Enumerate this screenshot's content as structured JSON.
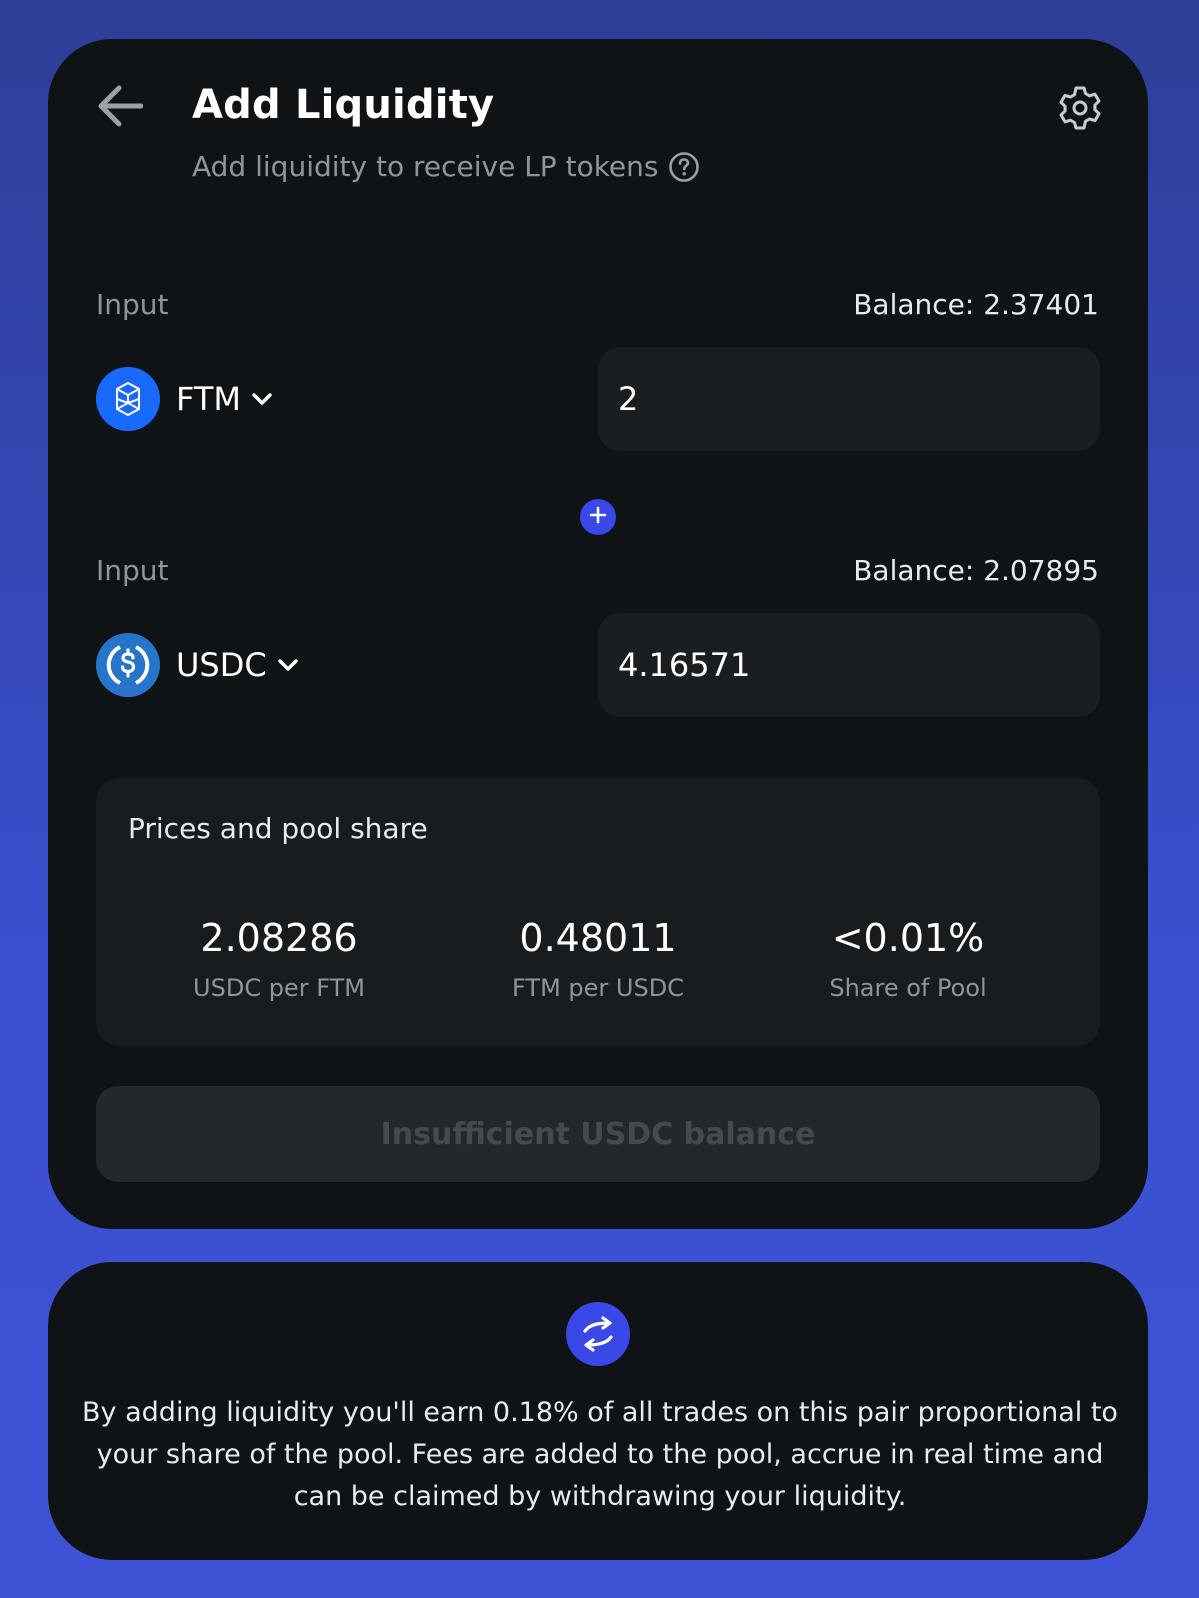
{
  "header": {
    "title": "Add Liquidity",
    "subtitle": "Add liquidity to receive LP tokens",
    "back_icon": "arrow-left-icon",
    "settings_icon": "gear-icon",
    "help_icon": "question-circle-icon"
  },
  "input_a": {
    "label": "Input",
    "balance": "Balance: 2.37401",
    "token": "FTM",
    "token_icon": "fantom-logo-icon",
    "token_color": "#1969ff",
    "amount": "2"
  },
  "input_b": {
    "label": "Input",
    "balance": "Balance: 2.07895",
    "token": "USDC",
    "token_icon": "usdc-logo-icon",
    "token_color": "#2775ca",
    "amount": "4.16571"
  },
  "plus_icon": "plus-icon",
  "prices": {
    "title": "Prices and pool share",
    "stats": [
      {
        "value": "2.08286",
        "label": "USDC per FTM"
      },
      {
        "value": "0.48011",
        "label": "FTM per USDC"
      },
      {
        "value": "<0.01%",
        "label": "Share of Pool"
      }
    ]
  },
  "action": {
    "label": "Insufficient USDC balance"
  },
  "info": {
    "icon": "swap-arrows-icon",
    "text": "By adding liquidity you'll earn 0.18% of all trades on this pair proportional to your share of the pool. Fees are added to the pool, accrue in real time and can be claimed by withdrawing your liquidity."
  },
  "colors": {
    "accent": "#3a48e8",
    "card_bg": "#0f1316",
    "field_bg": "#1a1e21"
  }
}
